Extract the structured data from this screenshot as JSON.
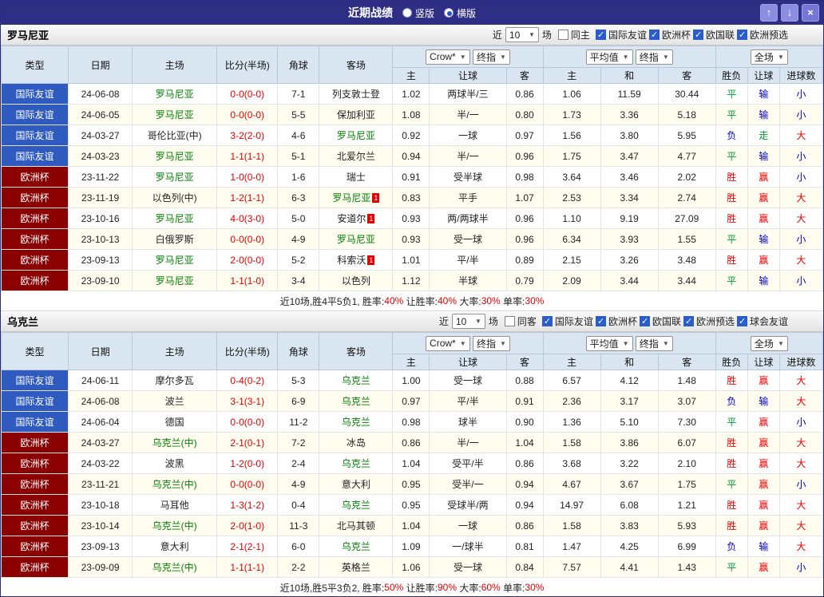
{
  "titlebar": {
    "title": "近期战绩",
    "vertical_label": "竖版",
    "horizontal_label": "横版",
    "up_icon": "↑",
    "down_icon": "↓",
    "close_icon": "×"
  },
  "filter_common": {
    "near_label": "近",
    "count_value": "10",
    "unit_label": "场"
  },
  "table_header": {
    "col_type": "类型",
    "col_date": "日期",
    "col_home": "主场",
    "col_score": "比分(半场)",
    "col_corner": "角球",
    "col_away": "客场",
    "odds_source_select": "Crow*",
    "odds_final_select": "终指",
    "odds_sub": [
      "主",
      "让球",
      "客"
    ],
    "europe_select": "平均值",
    "europe_final_select": "终指",
    "europe_sub": [
      "主",
      "和",
      "客"
    ],
    "result_select": "全场",
    "result_sub": [
      "胜负",
      "让球",
      "进球数"
    ]
  },
  "colors": {
    "titlebar_bg": "#2e2e85",
    "header_bg": "#d9e5f1",
    "row_alt_bg": "#fffdf0",
    "type_bg": {
      "国际友谊": "#2f5bc0",
      "欧洲杯": "#8b0000"
    },
    "team_name": "#008000",
    "score": "#e80000",
    "result_red": "#e80000",
    "result_green": "#009933",
    "result_blue": "#0000cc",
    "red_values": [
      "胜",
      "赢",
      "大"
    ],
    "green_values": [
      "平",
      "走"
    ],
    "blue_values": [
      "负",
      "输",
      "小"
    ]
  },
  "sections": [
    {
      "team": "罗马尼亚",
      "same_filter_label": "同主",
      "same_checked": false,
      "league_filters": [
        {
          "label": "国际友谊",
          "checked": true
        },
        {
          "label": "欧洲杯",
          "checked": true
        },
        {
          "label": "欧国联",
          "checked": true
        },
        {
          "label": "欧洲预选",
          "checked": true
        }
      ],
      "rows": [
        {
          "type": "国际友谊",
          "date": "24-06-08",
          "home": "罗马尼亚",
          "home_team": true,
          "home_card": "",
          "score": "0-0(0-0)",
          "corner": "7-1",
          "away": "列支敦士登",
          "away_team": false,
          "away_card": "",
          "odds": [
            "1.02",
            "两球半/三",
            "0.86"
          ],
          "europe": [
            "1.06",
            "11.59",
            "30.44"
          ],
          "results": [
            "平",
            "输",
            "小"
          ]
        },
        {
          "type": "国际友谊",
          "date": "24-06-05",
          "home": "罗马尼亚",
          "home_team": true,
          "home_card": "",
          "score": "0-0(0-0)",
          "corner": "5-5",
          "away": "保加利亚",
          "away_team": false,
          "away_card": "",
          "odds": [
            "1.08",
            "半/一",
            "0.80"
          ],
          "europe": [
            "1.73",
            "3.36",
            "5.18"
          ],
          "results": [
            "平",
            "输",
            "小"
          ]
        },
        {
          "type": "国际友谊",
          "date": "24-03-27",
          "home": "哥伦比亚(中)",
          "home_team": false,
          "home_card": "",
          "score": "3-2(2-0)",
          "corner": "4-6",
          "away": "罗马尼亚",
          "away_team": true,
          "away_card": "",
          "odds": [
            "0.92",
            "一球",
            "0.97"
          ],
          "europe": [
            "1.56",
            "3.80",
            "5.95"
          ],
          "results": [
            "负",
            "走",
            "大"
          ]
        },
        {
          "type": "国际友谊",
          "date": "24-03-23",
          "home": "罗马尼亚",
          "home_team": true,
          "home_card": "",
          "score": "1-1(1-1)",
          "corner": "5-1",
          "away": "北爱尔兰",
          "away_team": false,
          "away_card": "",
          "odds": [
            "0.94",
            "半/一",
            "0.96"
          ],
          "europe": [
            "1.75",
            "3.47",
            "4.77"
          ],
          "results": [
            "平",
            "输",
            "小"
          ]
        },
        {
          "type": "欧洲杯",
          "date": "23-11-22",
          "home": "罗马尼亚",
          "home_team": true,
          "home_card": "",
          "score": "1-0(0-0)",
          "corner": "1-6",
          "away": "瑞士",
          "away_team": false,
          "away_card": "",
          "odds": [
            "0.91",
            "受半球",
            "0.98"
          ],
          "europe": [
            "3.64",
            "3.46",
            "2.02"
          ],
          "results": [
            "胜",
            "赢",
            "小"
          ]
        },
        {
          "type": "欧洲杯",
          "date": "23-11-19",
          "home": "以色列(中)",
          "home_team": false,
          "home_card": "",
          "score": "1-2(1-1)",
          "corner": "6-3",
          "away": "罗马尼亚",
          "away_team": true,
          "away_card": "1",
          "odds": [
            "0.83",
            "平手",
            "1.07"
          ],
          "europe": [
            "2.53",
            "3.34",
            "2.74"
          ],
          "results": [
            "胜",
            "赢",
            "大"
          ]
        },
        {
          "type": "欧洲杯",
          "date": "23-10-16",
          "home": "罗马尼亚",
          "home_team": true,
          "home_card": "",
          "score": "4-0(3-0)",
          "corner": "5-0",
          "away": "安道尔",
          "away_team": false,
          "away_card": "1",
          "odds": [
            "0.93",
            "两/两球半",
            "0.96"
          ],
          "europe": [
            "1.10",
            "9.19",
            "27.09"
          ],
          "results": [
            "胜",
            "赢",
            "大"
          ]
        },
        {
          "type": "欧洲杯",
          "date": "23-10-13",
          "home": "白俄罗斯",
          "home_team": false,
          "home_card": "",
          "score": "0-0(0-0)",
          "corner": "4-9",
          "away": "罗马尼亚",
          "away_team": true,
          "away_card": "",
          "odds": [
            "0.93",
            "受一球",
            "0.96"
          ],
          "europe": [
            "6.34",
            "3.93",
            "1.55"
          ],
          "results": [
            "平",
            "输",
            "小"
          ]
        },
        {
          "type": "欧洲杯",
          "date": "23-09-13",
          "home": "罗马尼亚",
          "home_team": true,
          "home_card": "",
          "score": "2-0(0-0)",
          "corner": "5-2",
          "away": "科索沃",
          "away_team": false,
          "away_card": "1",
          "odds": [
            "1.01",
            "平/半",
            "0.89"
          ],
          "europe": [
            "2.15",
            "3.26",
            "3.48"
          ],
          "results": [
            "胜",
            "赢",
            "大"
          ]
        },
        {
          "type": "欧洲杯",
          "date": "23-09-10",
          "home": "罗马尼亚",
          "home_team": true,
          "home_card": "",
          "score": "1-1(1-0)",
          "corner": "3-4",
          "away": "以色列",
          "away_team": false,
          "away_card": "",
          "odds": [
            "1.12",
            "半球",
            "0.79"
          ],
          "europe": [
            "2.09",
            "3.44",
            "3.44"
          ],
          "results": [
            "平",
            "输",
            "小"
          ]
        }
      ],
      "summary": [
        {
          "text": "近10场,胜4平5负1, 胜率:",
          "highlight": false
        },
        {
          "text": "40%",
          "highlight": true
        },
        {
          "text": " 让胜率:",
          "highlight": false
        },
        {
          "text": "40%",
          "highlight": true
        },
        {
          "text": " 大率:",
          "highlight": false
        },
        {
          "text": "30%",
          "highlight": true
        },
        {
          "text": " 单率:",
          "highlight": false
        },
        {
          "text": "30%",
          "highlight": true
        }
      ]
    },
    {
      "team": "乌克兰",
      "same_filter_label": "同客",
      "same_checked": false,
      "league_filters": [
        {
          "label": "国际友谊",
          "checked": true
        },
        {
          "label": "欧洲杯",
          "checked": true
        },
        {
          "label": "欧国联",
          "checked": true
        },
        {
          "label": "欧洲预选",
          "checked": true
        },
        {
          "label": "球会友谊",
          "checked": true
        }
      ],
      "rows": [
        {
          "type": "国际友谊",
          "date": "24-06-11",
          "home": "摩尔多瓦",
          "home_team": false,
          "home_card": "",
          "score": "0-4(0-2)",
          "corner": "5-3",
          "away": "乌克兰",
          "away_team": true,
          "away_card": "",
          "odds": [
            "1.00",
            "受一球",
            "0.88"
          ],
          "europe": [
            "6.57",
            "4.12",
            "1.48"
          ],
          "results": [
            "胜",
            "赢",
            "大"
          ]
        },
        {
          "type": "国际友谊",
          "date": "24-06-08",
          "home": "波兰",
          "home_team": false,
          "home_card": "",
          "score": "3-1(3-1)",
          "corner": "6-9",
          "away": "乌克兰",
          "away_team": true,
          "away_card": "",
          "odds": [
            "0.97",
            "平/半",
            "0.91"
          ],
          "europe": [
            "2.36",
            "3.17",
            "3.07"
          ],
          "results": [
            "负",
            "输",
            "大"
          ]
        },
        {
          "type": "国际友谊",
          "date": "24-06-04",
          "home": "德国",
          "home_team": false,
          "home_card": "",
          "score": "0-0(0-0)",
          "corner": "11-2",
          "away": "乌克兰",
          "away_team": true,
          "away_card": "",
          "odds": [
            "0.98",
            "球半",
            "0.90"
          ],
          "europe": [
            "1.36",
            "5.10",
            "7.30"
          ],
          "results": [
            "平",
            "赢",
            "小"
          ]
        },
        {
          "type": "欧洲杯",
          "date": "24-03-27",
          "home": "乌克兰(中)",
          "home_team": true,
          "home_card": "",
          "score": "2-1(0-1)",
          "corner": "7-2",
          "away": "冰岛",
          "away_team": false,
          "away_card": "",
          "odds": [
            "0.86",
            "半/一",
            "1.04"
          ],
          "europe": [
            "1.58",
            "3.86",
            "6.07"
          ],
          "results": [
            "胜",
            "赢",
            "大"
          ]
        },
        {
          "type": "欧洲杯",
          "date": "24-03-22",
          "home": "波黑",
          "home_team": false,
          "home_card": "",
          "score": "1-2(0-0)",
          "corner": "2-4",
          "away": "乌克兰",
          "away_team": true,
          "away_card": "",
          "odds": [
            "1.04",
            "受平/半",
            "0.86"
          ],
          "europe": [
            "3.68",
            "3.22",
            "2.10"
          ],
          "results": [
            "胜",
            "赢",
            "大"
          ]
        },
        {
          "type": "欧洲杯",
          "date": "23-11-21",
          "home": "乌克兰(中)",
          "home_team": true,
          "home_card": "",
          "score": "0-0(0-0)",
          "corner": "4-9",
          "away": "意大利",
          "away_team": false,
          "away_card": "",
          "odds": [
            "0.95",
            "受半/一",
            "0.94"
          ],
          "europe": [
            "4.67",
            "3.67",
            "1.75"
          ],
          "results": [
            "平",
            "赢",
            "小"
          ]
        },
        {
          "type": "欧洲杯",
          "date": "23-10-18",
          "home": "马耳他",
          "home_team": false,
          "home_card": "",
          "score": "1-3(1-2)",
          "corner": "0-4",
          "away": "乌克兰",
          "away_team": true,
          "away_card": "",
          "odds": [
            "0.95",
            "受球半/两",
            "0.94"
          ],
          "europe": [
            "14.97",
            "6.08",
            "1.21"
          ],
          "results": [
            "胜",
            "赢",
            "大"
          ]
        },
        {
          "type": "欧洲杯",
          "date": "23-10-14",
          "home": "乌克兰(中)",
          "home_team": true,
          "home_card": "",
          "score": "2-0(1-0)",
          "corner": "11-3",
          "away": "北马其顿",
          "away_team": false,
          "away_card": "",
          "odds": [
            "1.04",
            "一球",
            "0.86"
          ],
          "europe": [
            "1.58",
            "3.83",
            "5.93"
          ],
          "results": [
            "胜",
            "赢",
            "大"
          ]
        },
        {
          "type": "欧洲杯",
          "date": "23-09-13",
          "home": "意大利",
          "home_team": false,
          "home_card": "",
          "score": "2-1(2-1)",
          "corner": "6-0",
          "away": "乌克兰",
          "away_team": true,
          "away_card": "",
          "odds": [
            "1.09",
            "一/球半",
            "0.81"
          ],
          "europe": [
            "1.47",
            "4.25",
            "6.99"
          ],
          "results": [
            "负",
            "输",
            "大"
          ]
        },
        {
          "type": "欧洲杯",
          "date": "23-09-09",
          "home": "乌克兰(中)",
          "home_team": true,
          "home_card": "",
          "score": "1-1(1-1)",
          "corner": "2-2",
          "away": "英格兰",
          "away_team": false,
          "away_card": "",
          "odds": [
            "1.06",
            "受一球",
            "0.84"
          ],
          "europe": [
            "7.57",
            "4.41",
            "1.43"
          ],
          "results": [
            "平",
            "赢",
            "小"
          ]
        }
      ],
      "summary": [
        {
          "text": "近10场,胜5平3负2, 胜率:",
          "highlight": false
        },
        {
          "text": "50%",
          "highlight": true
        },
        {
          "text": " 让胜率:",
          "highlight": false
        },
        {
          "text": "90%",
          "highlight": true
        },
        {
          "text": " 大率:",
          "highlight": false
        },
        {
          "text": "60%",
          "highlight": true
        },
        {
          "text": " 单率:",
          "highlight": false
        },
        {
          "text": "30%",
          "highlight": true
        }
      ]
    }
  ]
}
